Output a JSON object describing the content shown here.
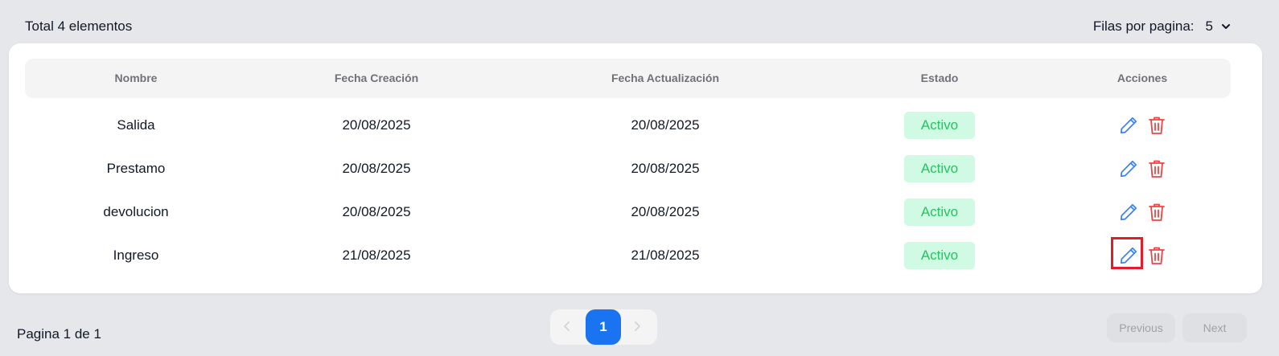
{
  "summary": {
    "total_text": "Total 4 elementos",
    "rows_per_page_label": "Filas por pagina:",
    "rows_per_page_value": "5"
  },
  "table": {
    "headers": [
      "Nombre",
      "Fecha Creación",
      "Fecha Actualización",
      "Estado",
      "Acciones"
    ],
    "rows": [
      {
        "nombre": "Salida",
        "creacion": "20/08/2025",
        "actualizacion": "20/08/2025",
        "estado": "Activo"
      },
      {
        "nombre": "Prestamo",
        "creacion": "20/08/2025",
        "actualizacion": "20/08/2025",
        "estado": "Activo"
      },
      {
        "nombre": "devolucion",
        "creacion": "20/08/2025",
        "actualizacion": "20/08/2025",
        "estado": "Activo"
      },
      {
        "nombre": "Ingreso",
        "creacion": "21/08/2025",
        "actualizacion": "21/08/2025",
        "estado": "Activo"
      }
    ]
  },
  "footer": {
    "page_info": "Pagina 1 de 1",
    "current_page": "1",
    "previous_label": "Previous",
    "next_label": "Next"
  },
  "colors": {
    "edit_icon": "#3b82f6",
    "delete_icon": "#ef4444",
    "active_badge_bg": "#d1fae5",
    "active_badge_text": "#22c55e",
    "current_page_bg": "#1a73f0",
    "highlight": "#e11d2a"
  },
  "icons": {
    "edit": "pencil-icon",
    "delete": "trash-icon",
    "rows_dropdown": "chevron-down-icon",
    "pager_prev": "chevron-left-icon",
    "pager_next": "chevron-right-icon"
  }
}
